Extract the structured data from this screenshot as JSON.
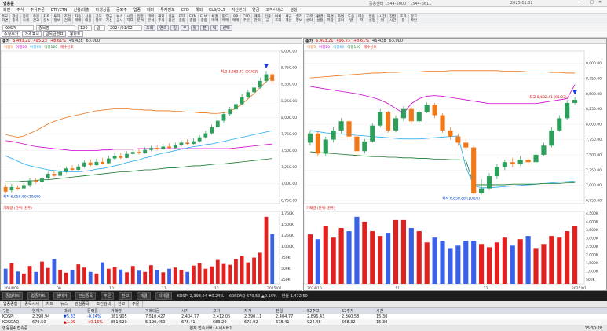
{
  "title_bar": {
    "app_title": "영웅문",
    "info_left": "공용센터 1544-5000 / 1544-6611",
    "info_right": "2025.01.02"
  },
  "menu": [
    "화면",
    "주식",
    "주식주문",
    "ETF/ETN",
    "신용/대출",
    "파생상품",
    "공모주",
    "업종",
    "테마",
    "투자정보",
    "CFD",
    "해외",
    "ELS/DLS",
    "자산관리",
    "연금",
    "고객서비스",
    "설정"
  ],
  "ribbon": [
    {
      "l1": "주요",
      "l2": "화면"
    },
    {
      "l1": "관심",
      "l2": "종목"
    },
    {
      "l1": "종목",
      "l2": "시세"
    },
    {
      "l1": "주문",
      "l2": "잔고"
    },
    {
      "l1": "차트",
      "l2": "분석"
    },
    {
      "l1": "투자",
      "l2": "정보"
    },
    {
      "l1": "조건",
      "l2": "검색"
    },
    {
      "l1": "자동",
      "l2": "매매"
    },
    {
      "l1": "신용",
      "l2": "대출"
    },
    {
      "l1": "공모",
      "l2": "청약"
    },
    {
      "l1": "연금",
      "l2": "자산"
    },
    {
      "l1": "뉴스",
      "l2": "공시"
    },
    {
      "l1": "시장",
      "l2": "지표"
    },
    {
      "l1": "업종",
      "l2": "분석"
    },
    {
      "l1": "테마",
      "l2": "분석"
    },
    {
      "l1": "해외",
      "l2": "주식"
    },
    {
      "l1": "선물",
      "l2": "옵션"
    },
    {
      "l1": "ETF",
      "l2": "종합"
    },
    {
      "l1": "ETN",
      "l2": "종합"
    },
    {
      "l1": "ELW",
      "l2": "종합"
    },
    {
      "l1": "채권",
      "l2": "매매"
    },
    {
      "l1": "펀드",
      "l2": "매매"
    },
    {
      "l1": "RP",
      "l2": "매매"
    },
    {
      "l1": "CFD",
      "l2": "주문"
    },
    {
      "l1": "계좌",
      "l2": "관리"
    },
    {
      "l1": "입출",
      "l2": "금"
    },
    {
      "l1": "이체",
      "l2": "조회"
    },
    {
      "l1": "세금",
      "l2": "계산"
    },
    {
      "l1": "권리",
      "l2": "정보"
    },
    {
      "l1": "고객",
      "l2": "센터"
    },
    {
      "l1": "환경",
      "l2": "설정"
    },
    {
      "l1": "화면",
      "l2": "저장"
    },
    {
      "l1": "화면",
      "l2": "불러"
    },
    {
      "l1": "도움",
      "l2": "말"
    },
    {
      "l1": "메신",
      "l2": "저"
    },
    {
      "l1": "알림",
      "l2": "설정"
    },
    {
      "l1": "시간",
      "l2": "외"
    },
    {
      "l1": "장전",
      "l2": "시간"
    },
    {
      "l1": "호가",
      "l2": "창"
    },
    {
      "l1": "잔고",
      "l2": "확인"
    }
  ],
  "controls": {
    "code": "KOSPI",
    "name": "종목명",
    "period": "120",
    "type": "일",
    "date": "2024/01/02",
    "buttons": [
      "조회",
      "연속",
      "일",
      "주",
      "월",
      "분",
      "틱",
      "선택"
    ],
    "options": [
      "수정주가",
      "가격표시",
      "일목균형표",
      "봉차트"
    ]
  },
  "left_chart": {
    "header": {
      "label": "종가",
      "price": "6,493.21",
      "change": "495.23",
      "pct": "+8.61%",
      "vol": "46,428",
      "amount": "63,000"
    },
    "legend": [
      "이평5",
      "이평20",
      "이평60",
      "이평120",
      "매수신호"
    ],
    "marker_max": "최고 8,682.41 (01/03)",
    "marker_min": "최저 6,058.60 (10/29)",
    "y_ticks": [
      "9,000.00",
      "8,750.00",
      "8,500.00",
      "8,250.00",
      "8,000.00",
      "7,750.00",
      "7,500.00",
      "7,250.00",
      "7,000.00",
      "6,750.00"
    ],
    "vol_label": "거래량 (단위: 천주)",
    "vol_ticks": [
      "1,750K",
      "1,500K",
      "1,250K",
      "1,000K",
      "750K",
      "500K",
      "250K"
    ],
    "x_ticks": [
      "2024/08",
      "09",
      "10",
      "11",
      "12",
      "2025/01"
    ]
  },
  "right_chart": {
    "header": {
      "label": "종가",
      "price": "6,493.21",
      "change": "495.23",
      "pct": "+8.61%",
      "vol": "46,428",
      "amount": "63,000"
    },
    "legend": [
      "이평5",
      "이평20",
      "이평60",
      "이평120",
      "매수신호"
    ],
    "marker_max": "최고 8,682.41 (01/03)",
    "marker_min": "최저 6,850.88 (10/16)",
    "y_ticks": [
      "9,000.00",
      "8,750.00",
      "8,500.00",
      "8,250.00",
      "8,000.00",
      "7,750.00",
      "7,500.00",
      "7,250.00",
      "7,000.00",
      "6,750.00"
    ],
    "vol_label": "거래량 (단위: 천주)",
    "vol_ticks": [
      "4,500K",
      "4,000K",
      "3,500K",
      "3,000K",
      "2,500K",
      "2,000K",
      "1,500K",
      "1,000K",
      "500K"
    ],
    "x_ticks": [
      "2024/10",
      "11",
      "12",
      "2025/01"
    ]
  },
  "mid_bar": {
    "items": [
      "종합차트",
      "업종차트",
      "현재가",
      "관심종목",
      "주문",
      "잔고",
      "체결",
      "미체결",
      "KOSPI 2,398.94 ▼0.24%",
      "KOSDAQ 679.50 ▲0.16%",
      "환율 1,472.50"
    ]
  },
  "tabs": [
    "업종종합",
    "종목시세",
    "차트",
    "뉴스",
    "관심종목",
    "조건검색",
    "잔고",
    "주문"
  ],
  "ticker_head": [
    "구분",
    "현재가",
    "대비",
    "등락률",
    "거래량",
    "거래대금",
    "시가",
    "고가",
    "저가",
    "전일",
    "52주고",
    "52주저",
    "시간"
  ],
  "ticker_rows": [
    [
      "KOSPI",
      "2,398.94",
      "▼5.83",
      "-0.24%",
      "381,905",
      "7,510,427",
      "2,404.77",
      "2,412.05",
      "2,390.11",
      "2,404.77",
      "2,896.43",
      "2,360.58",
      "15:30"
    ],
    [
      "KOSDAQ",
      "679.50",
      "▲1.09",
      "+0.16%",
      "851,520",
      "5,190,450",
      "678.41",
      "683.20",
      "675.92",
      "678.41",
      "924.48",
      "668.32",
      "15:30"
    ]
  ],
  "status": {
    "left": "영웅문4 접속중",
    "center": "현재 접속서버: 시세서버1",
    "right": "15:30:28"
  },
  "chart_data": [
    {
      "type": "candlestick",
      "title": "",
      "y_range": [
        6700,
        9000
      ],
      "candles": [
        [
          6950,
          6880,
          6990,
          6860
        ],
        [
          6900,
          6950,
          7000,
          6870
        ],
        [
          6940,
          6920,
          6980,
          6900
        ],
        [
          6930,
          6980,
          7010,
          6910
        ],
        [
          6980,
          7050,
          7080,
          6950
        ],
        [
          7050,
          7020,
          7090,
          7000
        ],
        [
          7020,
          7080,
          7110,
          7010
        ],
        [
          7090,
          7150,
          7180,
          7070
        ],
        [
          7150,
          7120,
          7190,
          7100
        ],
        [
          7120,
          7180,
          7220,
          7110
        ],
        [
          7180,
          7230,
          7260,
          7160
        ],
        [
          7230,
          7210,
          7280,
          7190
        ],
        [
          7210,
          7260,
          7300,
          7200
        ],
        [
          7260,
          7320,
          7350,
          7240
        ],
        [
          7320,
          7280,
          7370,
          7260
        ],
        [
          7280,
          7330,
          7380,
          7270
        ],
        [
          7330,
          7300,
          7390,
          7290
        ],
        [
          7310,
          7380,
          7420,
          7300
        ],
        [
          7380,
          7420,
          7460,
          7360
        ],
        [
          7420,
          7390,
          7470,
          7370
        ],
        [
          7390,
          7450,
          7490,
          7380
        ],
        [
          7450,
          7480,
          7520,
          7430
        ],
        [
          7480,
          7460,
          7530,
          7440
        ],
        [
          7460,
          7510,
          7550,
          7450
        ],
        [
          7510,
          7540,
          7570,
          7490
        ],
        [
          7540,
          7520,
          7590,
          7500
        ],
        [
          7520,
          7560,
          7600,
          7510
        ],
        [
          7560,
          7540,
          7610,
          7520
        ],
        [
          7540,
          7580,
          7620,
          7530
        ],
        [
          7580,
          7620,
          7650,
          7560
        ],
        [
          7620,
          7600,
          7670,
          7580
        ],
        [
          7600,
          7640,
          7690,
          7590
        ],
        [
          7640,
          7700,
          7730,
          7620
        ],
        [
          7700,
          7760,
          7800,
          7680
        ],
        [
          7760,
          7850,
          7890,
          7740
        ],
        [
          7850,
          7950,
          7990,
          7830
        ],
        [
          7950,
          8050,
          8090,
          7920
        ],
        [
          8050,
          8120,
          8160,
          8020
        ],
        [
          8120,
          8200,
          8250,
          8100
        ],
        [
          8200,
          8300,
          8350,
          8180
        ],
        [
          8300,
          8380,
          8420,
          8280
        ],
        [
          8380,
          8450,
          8500,
          8350
        ],
        [
          8450,
          8550,
          8600,
          8430
        ],
        [
          8550,
          8650,
          8700,
          8520
        ],
        [
          8650,
          8550,
          8682,
          8500
        ]
      ],
      "ma_short": [
        7740,
        7720,
        7700,
        7720,
        7760,
        7800,
        7850,
        7900,
        7940,
        7970,
        8000,
        8020,
        8040,
        8060,
        8080,
        8100,
        8110,
        8120,
        8130,
        8130,
        8130,
        8120,
        8120,
        8110,
        8110,
        8100,
        8100,
        8100,
        8090,
        8090,
        8080,
        8080,
        8070,
        8070,
        8060,
        8060,
        8070,
        8090,
        8140,
        8200,
        8280,
        8360,
        8450,
        8540,
        8620
      ],
      "ma_mid": [
        7650,
        7640,
        7620,
        7600,
        7580,
        7560,
        7550,
        7540,
        7530,
        7520,
        7510,
        7500,
        7500,
        7500,
        7500,
        7500,
        7510,
        7510,
        7520,
        7520,
        7520,
        7520,
        7530,
        7530,
        7530,
        7530,
        7530,
        7530,
        7530,
        7530,
        7530,
        7530,
        7530,
        7530,
        7530,
        7530,
        7530,
        7530,
        7540,
        7550,
        7560,
        7570,
        7580,
        7590,
        7600
      ],
      "ma_long": [
        7420,
        7380,
        7340,
        7300,
        7270,
        7250,
        7230,
        7210,
        7200,
        7190,
        7180,
        7180,
        7180,
        7190,
        7200,
        7220,
        7230,
        7250,
        7270,
        7290,
        7320,
        7340,
        7360,
        7390,
        7410,
        7440,
        7460,
        7480,
        7500,
        7520,
        7540,
        7560,
        7570,
        7590,
        7600,
        7620,
        7640,
        7660,
        7680,
        7700,
        7720,
        7740,
        7760,
        7780,
        7800
      ],
      "ma_xlong": [
        7030,
        7030,
        7030,
        7040,
        7040,
        7050,
        7060,
        7060,
        7070,
        7080,
        7090,
        7100,
        7110,
        7120,
        7130,
        7140,
        7150,
        7160,
        7170,
        7180,
        7180,
        7190,
        7200,
        7210,
        7210,
        7220,
        7230,
        7240,
        7240,
        7250,
        7260,
        7270,
        7270,
        7280,
        7290,
        7300,
        7300,
        7310,
        7320,
        7330,
        7340,
        7350,
        7360,
        7370,
        7380
      ],
      "volume": [
        380,
        520,
        310,
        260,
        450,
        300,
        560,
        400,
        620,
        350,
        280,
        340,
        490,
        410,
        300,
        260,
        540,
        380,
        420,
        360,
        290,
        450,
        330,
        300,
        470,
        350,
        290,
        380,
        410,
        340,
        300,
        460,
        520,
        380,
        440,
        600,
        500,
        480,
        620,
        700,
        540,
        660,
        780,
        1680,
        1250
      ]
    },
    {
      "type": "candlestick",
      "title": "",
      "y_range": [
        6700,
        9200
      ],
      "candles": [
        [
          7700,
          7850,
          7900,
          7650
        ],
        [
          7850,
          7520,
          7880,
          7480
        ],
        [
          7520,
          7750,
          7800,
          7480
        ],
        [
          7750,
          7900,
          7950,
          7700
        ],
        [
          7900,
          8050,
          8100,
          7850
        ],
        [
          8050,
          7800,
          8080,
          7750
        ],
        [
          7800,
          7560,
          7850,
          7500
        ],
        [
          7560,
          7720,
          7760,
          7520
        ],
        [
          7720,
          7980,
          8020,
          7700
        ],
        [
          7980,
          8200,
          8250,
          7950
        ],
        [
          8200,
          7900,
          8220,
          7860
        ],
        [
          7900,
          8100,
          8150,
          7870
        ],
        [
          8100,
          8250,
          8300,
          8050
        ],
        [
          8250,
          8050,
          8280,
          8000
        ],
        [
          8050,
          8200,
          8240,
          8020
        ],
        [
          8200,
          8320,
          8360,
          8180
        ],
        [
          8320,
          8150,
          8350,
          8100
        ],
        [
          8150,
          7900,
          8180,
          7860
        ],
        [
          7900,
          7800,
          7950,
          7750
        ],
        [
          7800,
          7700,
          7850,
          7650
        ],
        [
          7700,
          7620,
          7760,
          7580
        ],
        [
          7620,
          6870,
          7650,
          6850
        ],
        [
          6870,
          6950,
          7100,
          6850
        ],
        [
          6950,
          7150,
          7200,
          6920
        ],
        [
          7150,
          7300,
          7350,
          7100
        ],
        [
          7300,
          7380,
          7420,
          7250
        ],
        [
          7380,
          7350,
          7450,
          7300
        ],
        [
          7350,
          7420,
          7480,
          7320
        ],
        [
          7420,
          7380,
          7460,
          7340
        ],
        [
          7380,
          7500,
          7550,
          7350
        ],
        [
          7500,
          7650,
          7700,
          7480
        ],
        [
          7650,
          7900,
          7950,
          7620
        ],
        [
          7900,
          8100,
          8150,
          7880
        ],
        [
          8100,
          8350,
          8400,
          8080
        ],
        [
          8350,
          8400,
          8450,
          8320
        ]
      ],
      "ma_short": [
        8760,
        8770,
        8780,
        8790,
        8800,
        8810,
        8820,
        8830,
        8840,
        8840,
        8850,
        8850,
        8860,
        8860,
        8860,
        8870,
        8870,
        8870,
        8880,
        8880,
        8880,
        8880,
        8880,
        8880,
        8880,
        8870,
        8870,
        8870,
        8860,
        8860,
        8860,
        8850,
        8850,
        8840,
        8840
      ],
      "ma_mid": [
        8620,
        8600,
        8580,
        8560,
        8540,
        8520,
        8500,
        8470,
        8440,
        8400,
        8340,
        8260,
        8180,
        8340,
        8420,
        8460,
        8470,
        8460,
        8440,
        8420,
        8400,
        8380,
        8360,
        8340,
        8340,
        8340,
        8340,
        8340,
        8340,
        8340,
        8360,
        8380,
        8400,
        8420,
        8650
      ],
      "ma_long": [
        7900,
        7880,
        7860,
        7850,
        7840,
        7830,
        7820,
        7810,
        7800,
        7790,
        7780,
        7770,
        7760,
        7760,
        7760,
        7770,
        7780,
        7790,
        7800,
        7810,
        7300,
        7000,
        6960,
        6960,
        6970,
        6980,
        6990,
        7000,
        7010,
        7020,
        7030,
        7040,
        7050,
        7060,
        7070
      ],
      "ma_xlong": [
        7550,
        7540,
        7530,
        7520,
        7510,
        7500,
        7490,
        7480,
        7470,
        7470,
        7460,
        7460,
        7450,
        7450,
        7440,
        7440,
        7430,
        7430,
        7420,
        7420,
        7410,
        7010,
        7010,
        7010,
        7010,
        7010,
        7020,
        7020,
        7020,
        7020,
        7030,
        7030,
        7030,
        7040,
        7040
      ],
      "volume": [
        3100,
        2800,
        3600,
        2900,
        3500,
        3300,
        4200,
        3900,
        3300,
        3000,
        3200,
        4000,
        4000,
        3500,
        3300,
        2600,
        2900,
        2700,
        2200,
        2400,
        2700,
        2700,
        2500,
        2300,
        2600,
        2900,
        2400,
        2800,
        3000,
        2200,
        2500,
        3000,
        2900,
        3300,
        3600
      ]
    }
  ]
}
